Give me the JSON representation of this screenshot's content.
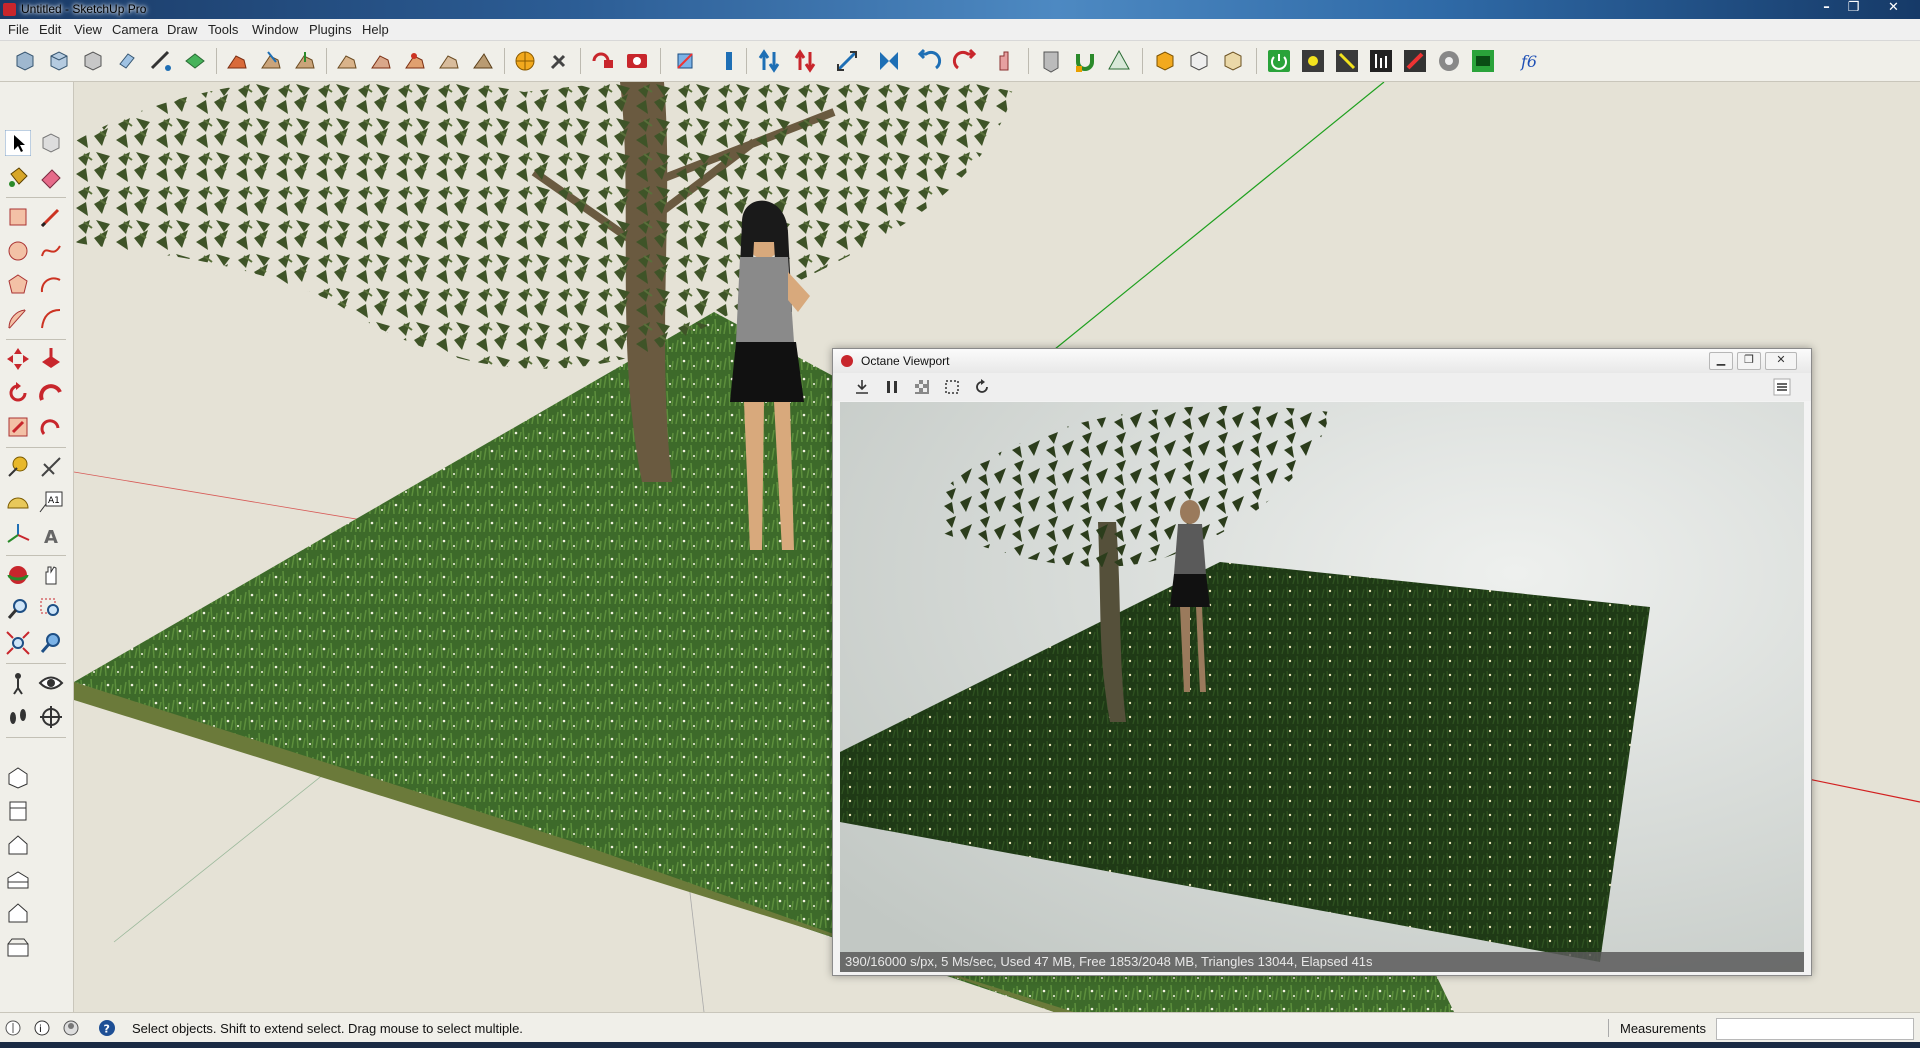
{
  "window": {
    "title": "Untitled - SketchUp Pro",
    "controls": [
      "minimize-icon",
      "restore-icon",
      "close-icon"
    ]
  },
  "menu": {
    "items": [
      "File",
      "Edit",
      "View",
      "Camera",
      "Draw",
      "Tools",
      "Window",
      "Plugins",
      "Help"
    ]
  },
  "octane": {
    "title": "Octane Viewport",
    "status": "390/16000 s/px, 5 Ms/sec, Used 47 MB, Free 1853/2048 MB, Triangles 13044, Elapsed 41s"
  },
  "statusbar": {
    "hint": "Select objects. Shift to extend select. Drag mouse to select multiple.",
    "measurements_label": "Measurements",
    "measurements_value": ""
  },
  "colors": {
    "background": "#e5e2d6",
    "grass": "#3f6a2a",
    "green_axis": "#1fa01f",
    "red_axis": "#d22020",
    "accent_red": "#c8262c"
  }
}
